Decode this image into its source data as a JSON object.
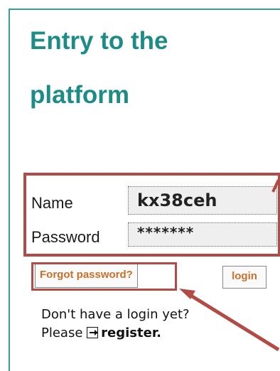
{
  "title": "Entry to the platform",
  "form": {
    "name_label": "Name",
    "name_value": "kx38ceh",
    "password_label": "Password",
    "password_value": "*******"
  },
  "buttons": {
    "forgot_label": "Forgot password?",
    "login_label": "login"
  },
  "register": {
    "line1": "Don't have a login yet?",
    "line2_prefix": "Please",
    "link_label": "register.",
    "icon": "login-arrow-icon"
  },
  "colors": {
    "title": "#1e8c86",
    "border": "#3a9c98",
    "highlight": "#b24a46",
    "link_orange": "#c8702a"
  }
}
